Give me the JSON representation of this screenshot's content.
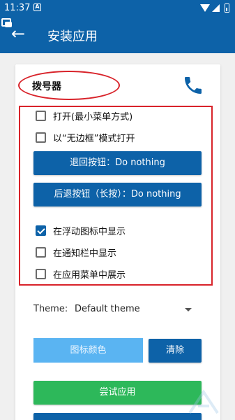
{
  "statusbar": {
    "time": "11:37",
    "notif_glyph": "A"
  },
  "appbar": {
    "title": "安装应用",
    "back_glyph": "←"
  },
  "app": {
    "name": "拨号器"
  },
  "options": [
    {
      "label": "打开(最小菜单方式)",
      "checked": false
    },
    {
      "label": "以“无边框”模式打开",
      "checked": false
    }
  ],
  "buttons": {
    "back_action": "退回按钮：Do nothing",
    "long_back_action": "后退按钮（长按）：Do nothing",
    "icon_color": "图标颜色",
    "clear": "清除",
    "try_app": "尝试应用"
  },
  "display_options": [
    {
      "label": "在浮动图标中显示",
      "checked": true
    },
    {
      "label": "在通知栏中显示",
      "checked": false
    },
    {
      "label": "在应用菜单中展示",
      "checked": false
    }
  ],
  "theme": {
    "label": "Theme:",
    "value": "Default theme"
  },
  "colors": {
    "primary": "#0d62a8",
    "accent_green": "#2db85a",
    "light_blue": "#5ab4f2",
    "highlight_red": "#d8232a"
  },
  "icons": [
    "overlay-windows-icon",
    "back-arrow-icon",
    "phone-icon",
    "wifi-icon",
    "cell-signal-icon",
    "battery-icon",
    "dropdown-arrow-icon"
  ]
}
